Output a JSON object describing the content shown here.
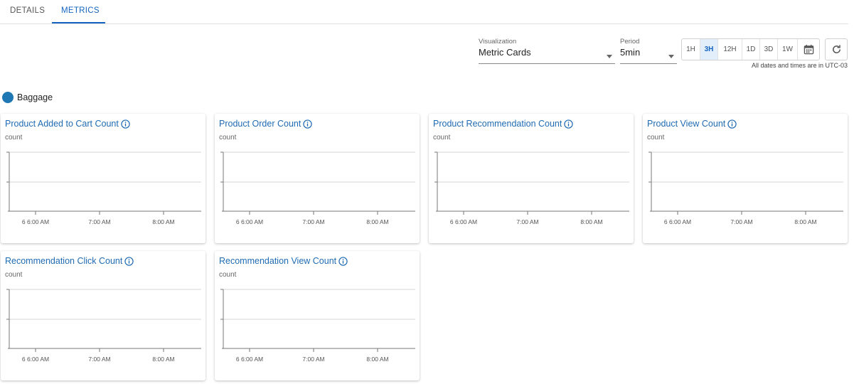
{
  "tabs": [
    {
      "label": "DETAILS",
      "active": false
    },
    {
      "label": "METRICS",
      "active": true
    }
  ],
  "controls": {
    "visualization": {
      "label": "Visualization",
      "value": "Metric Cards"
    },
    "period": {
      "label": "Period",
      "value": "5min"
    },
    "ranges": [
      {
        "label": "1H",
        "active": false
      },
      {
        "label": "3H",
        "active": true
      },
      {
        "label": "12H",
        "active": false
      },
      {
        "label": "1D",
        "active": false
      },
      {
        "label": "3D",
        "active": false
      },
      {
        "label": "1W",
        "active": false
      }
    ],
    "timezone_note": "All dates and times are in UTC-03"
  },
  "legend": {
    "label": "Baggage",
    "color": "#1f77b4"
  },
  "time_ticks": [
    "6 6:00 AM",
    "7:00 AM",
    "8:00 AM"
  ],
  "cards": [
    {
      "title": "Product Added to Cart Count",
      "unit": "count"
    },
    {
      "title": "Product Order Count",
      "unit": "count"
    },
    {
      "title": "Product Recommendation Count",
      "unit": "count"
    },
    {
      "title": "Product View Count",
      "unit": "count"
    },
    {
      "title": "Recommendation Click Count",
      "unit": "count"
    },
    {
      "title": "Recommendation View Count",
      "unit": "count"
    }
  ],
  "colors": {
    "accent": "#1565c0",
    "title": "#1f6bb3",
    "series": "#1f77b4"
  }
}
